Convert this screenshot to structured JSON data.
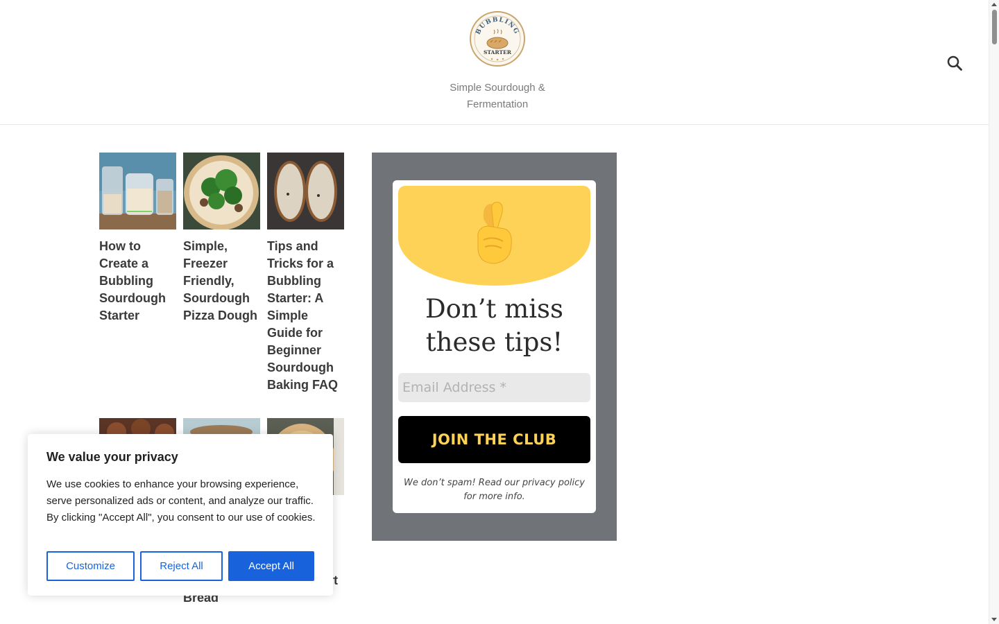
{
  "header": {
    "logo": {
      "text_top": "BUBBLING",
      "text_bottom": "STARTER"
    },
    "tagline_line1": "Simple Sourdough &",
    "tagline_line2": "Fermentation",
    "search_icon": "search-icon"
  },
  "posts": [
    {
      "title": "How to Create a Bubbling Sourdough Starter",
      "image": "sourdough-starter-jars"
    },
    {
      "title": "Simple, Freezer Friendly, Sourdough Pizza Dough",
      "image": "pizza-with-greens"
    },
    {
      "title": "Tips and Tricks for a Bubbling Starter: A Simple Guide for Beginner Sourdough Baking FAQ",
      "image": "bread-slices"
    },
    {
      "title": "",
      "image": "glazed-buns"
    },
    {
      "title": "Bread",
      "image": "loaf-on-plate"
    },
    {
      "title": "rt",
      "image": "apple-tart"
    }
  ],
  "newsletter": {
    "emoji": "crossed-fingers",
    "heading_line1": "Don’t miss",
    "heading_line2": "these tips!",
    "email_placeholder": "Email Address *",
    "button_label": "JOIN THE CLUB",
    "note_line1": "We don’t spam! Read our privacy policy",
    "note_line2": "for more info.",
    "colors": {
      "panel": "#707479",
      "accent": "#fdd257",
      "button": "#000000"
    }
  },
  "cookie_banner": {
    "title": "We value your privacy",
    "body": "We use cookies to enhance your browsing experience, serve personalized ads or content, and analyze our traffic. By clicking \"Accept All\", you consent to our use of cookies.",
    "customize_label": "Customize",
    "reject_label": "Reject All",
    "accept_label": "Accept All",
    "accent_color": "#1863dc"
  }
}
